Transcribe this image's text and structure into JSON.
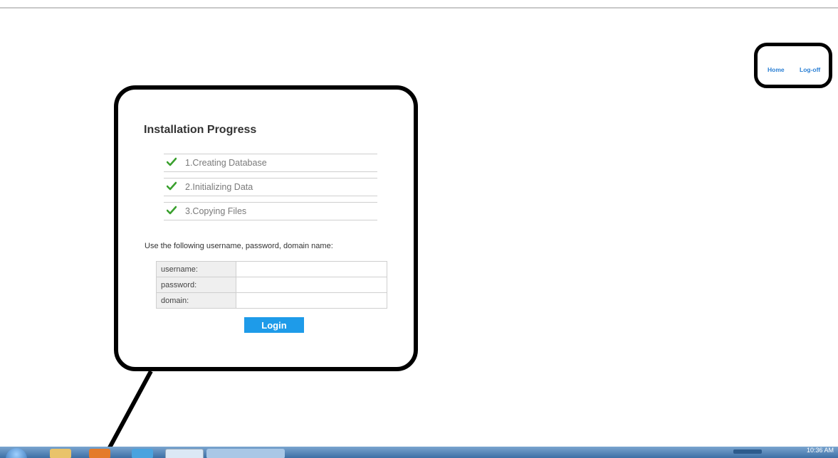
{
  "nav": {
    "home_label": "Home",
    "logoff_label": "Log-off"
  },
  "installation": {
    "title": "Installation Progress",
    "steps": [
      {
        "label": "1.Creating Database",
        "status": "done"
      },
      {
        "label": "2.Initializing Data",
        "status": "done"
      },
      {
        "label": "3.Copying Files",
        "status": "done"
      }
    ],
    "instructions": "Use the following username, password, domain name:",
    "credentials": {
      "username_label": "username:",
      "password_label": "password:",
      "domain_label": "domain:",
      "username_value": "",
      "password_value": "",
      "domain_value": ""
    },
    "login_label": "Login"
  },
  "taskbar": {
    "clock": "10:36 AM"
  },
  "colors": {
    "link": "#2a7fd4",
    "check": "#3aa02e",
    "button": "#1e9be9",
    "callout_border": "#000000"
  },
  "icons": [
    "check-icon",
    "windows-start-icon",
    "internet-explorer-icon",
    "folder-icon"
  ]
}
